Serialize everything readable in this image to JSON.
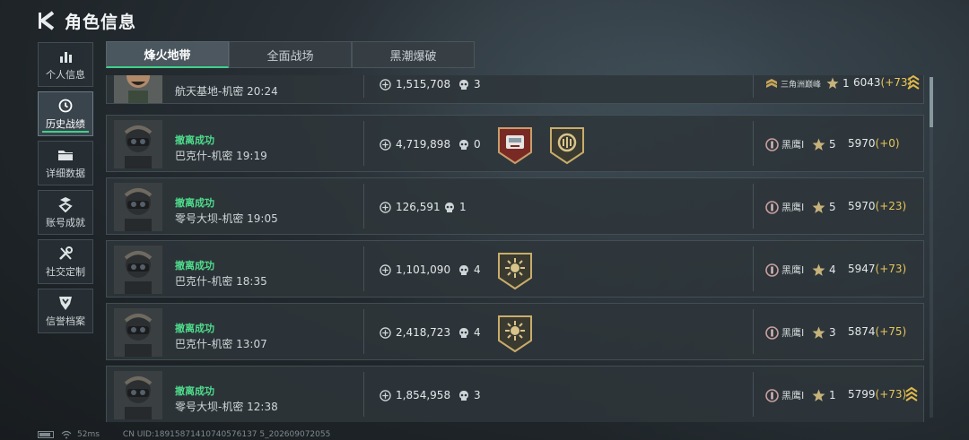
{
  "header": {
    "title": "角色信息"
  },
  "sidebar": {
    "items": [
      {
        "label": "个人信息",
        "icon": "bar-chart-icon",
        "active": false
      },
      {
        "label": "历史战绩",
        "icon": "clock-icon",
        "active": true
      },
      {
        "label": "详细数据",
        "icon": "folder-icon",
        "active": false
      },
      {
        "label": "账号成就",
        "icon": "medal-icon",
        "active": false
      },
      {
        "label": "社交定制",
        "icon": "tools-icon",
        "active": false
      },
      {
        "label": "信誉档案",
        "icon": "shield-icon",
        "active": false
      }
    ]
  },
  "tabs": [
    {
      "label": "烽火地带",
      "active": true
    },
    {
      "label": "全面战场",
      "active": false
    },
    {
      "label": "黑潮爆破",
      "active": false
    }
  ],
  "rows": [
    {
      "status": "",
      "map": "航天基地-机密 20:24",
      "value": "1,515,708",
      "kills": "3",
      "rank": "三角洲巅峰",
      "level": "1",
      "score": "6043",
      "delta": "(+73)"
    },
    {
      "status": "撤离成功",
      "map": "巴克什-机密 19:19",
      "value": "4,719,898",
      "kills": "0",
      "rank": "黑鹰I",
      "level": "5",
      "score": "5970",
      "delta": "(+0)"
    },
    {
      "status": "撤离成功",
      "map": "零号大坝-机密 19:05",
      "value": "126,591",
      "kills": "1",
      "rank": "黑鹰I",
      "level": "5",
      "score": "5970",
      "delta": "(+23)"
    },
    {
      "status": "撤离成功",
      "map": "巴克什-机密 18:35",
      "value": "1,101,090",
      "kills": "4",
      "rank": "黑鹰I",
      "level": "4",
      "score": "5947",
      "delta": "(+73)"
    },
    {
      "status": "撤离成功",
      "map": "巴克什-机密 13:07",
      "value": "2,418,723",
      "kills": "4",
      "rank": "黑鹰I",
      "level": "3",
      "score": "5874",
      "delta": "(+75)"
    },
    {
      "status": "撤离成功",
      "map": "零号大坝-机密 12:38",
      "value": "1,854,958",
      "kills": "3",
      "rank": "黑鹰I",
      "level": "1",
      "score": "5799",
      "delta": "(+73)"
    }
  ],
  "footer": {
    "ping": "52ms",
    "uid": "CN UID:18915871410740576137 5_202609072055"
  },
  "colors": {
    "accent": "#3fd28a",
    "status_success": "#4fdc8c",
    "delta": "#e6c65a"
  }
}
